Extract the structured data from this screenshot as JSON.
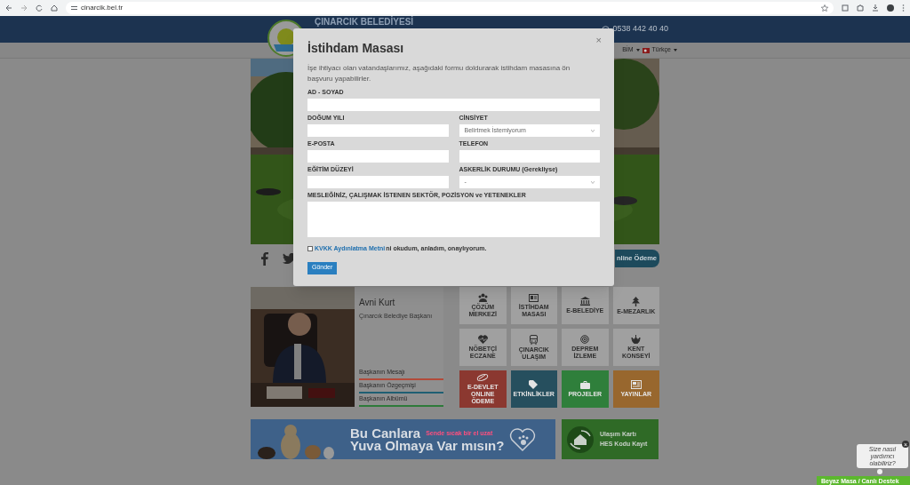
{
  "browser": {
    "url": "cinarcik.bel.tr"
  },
  "header": {
    "title": "ÇINARCIK BELEDİYESİ",
    "phone": "0538 442 40 40"
  },
  "nav": {
    "cut_item": "BİM",
    "language": "Türkçe"
  },
  "payment_button": "nline Ödeme",
  "mayor": {
    "name": "Avni Kurt",
    "role": "Çınarcık Belediye Başkanı",
    "links": [
      {
        "label": "Başkanın Mesajı",
        "color": "#b24a3a"
      },
      {
        "label": "Başkanın Özgeçmişi",
        "color": "#1f5f73"
      },
      {
        "label": "Başkanın Albümü",
        "color": "#2e7a3a"
      }
    ]
  },
  "tiles": [
    {
      "label": "ÇÖZÜM MERKEZİ",
      "color": "#a0a0a0"
    },
    {
      "label": "İSTİHDAM MASASI",
      "color": "#a0a0a0"
    },
    {
      "label": "E-BELEDİYE",
      "color": "#a0a0a0"
    },
    {
      "label": "E-MEZARLIK",
      "color": "#a0a0a0"
    },
    {
      "label": "NÖBETÇİ ECZANE",
      "color": "#a0a0a0"
    },
    {
      "label": "ÇINARCIK ULAŞIM",
      "color": "#a0a0a0"
    },
    {
      "label": "DEPREM İZLEME",
      "color": "#a0a0a0"
    },
    {
      "label": "KENT KONSEYİ",
      "color": "#a0a0a0"
    },
    {
      "label": "E-DEVLET ONLINE ÖDEME",
      "color": "#8b3830"
    },
    {
      "label": "ETKİNLİKLER",
      "color": "#264f5e"
    },
    {
      "label": "PROJELER",
      "color": "#2f7f3b"
    },
    {
      "label": "YAYINLAR",
      "color": "#98672e"
    }
  ],
  "banners": {
    "adoption": {
      "line_1": "Bu Canlara",
      "slogan": "Sende sıcak bir el uzat",
      "line_2": "Yuva Olmaya Var mısın?"
    },
    "card": {
      "line_1": "Ulaşım Kartı",
      "line_2": "HES Kodu Kayıt"
    }
  },
  "modal": {
    "title": "İstihdam Masası",
    "intro": "İşe ihtiyacı olan vatandaşlarımız, aşağıdaki formu doldurarak istihdam masasına ön başvuru yapabilirler.",
    "close": "×",
    "fields": [
      {
        "label": "AD - SOYAD",
        "kind": "line"
      },
      {
        "label": "DOĞUM YILI",
        "kind": "text"
      },
      {
        "label": "CİNSİYET",
        "kind": "select",
        "value": "Belirtmek İstemiyorum"
      },
      {
        "label": "E-POSTA",
        "kind": "text"
      },
      {
        "label": "TELEFON",
        "kind": "text"
      },
      {
        "label": "EĞİTİM DÜZEYİ",
        "kind": "text"
      },
      {
        "label": "ASKERLİK DURUMU (Gerekliyse)",
        "kind": "select",
        "value": "-"
      },
      {
        "label": "MESLEĞİNİZ, ÇALIŞMAK İSTENEN SEKTÖR, POZİSYON ve YETENEKLER",
        "kind": "textarea"
      }
    ],
    "consent": {
      "checked": false,
      "link": "KVKK Aydınlatma Metni",
      "text": "ni okudum, anladım, onaylıyorum."
    },
    "submit": "Gönder"
  },
  "chat": {
    "bubble": "Size nasıl yardımcı olabiliriz?",
    "close": "×",
    "bar": "Beyaz Masa / Canlı Destek"
  }
}
